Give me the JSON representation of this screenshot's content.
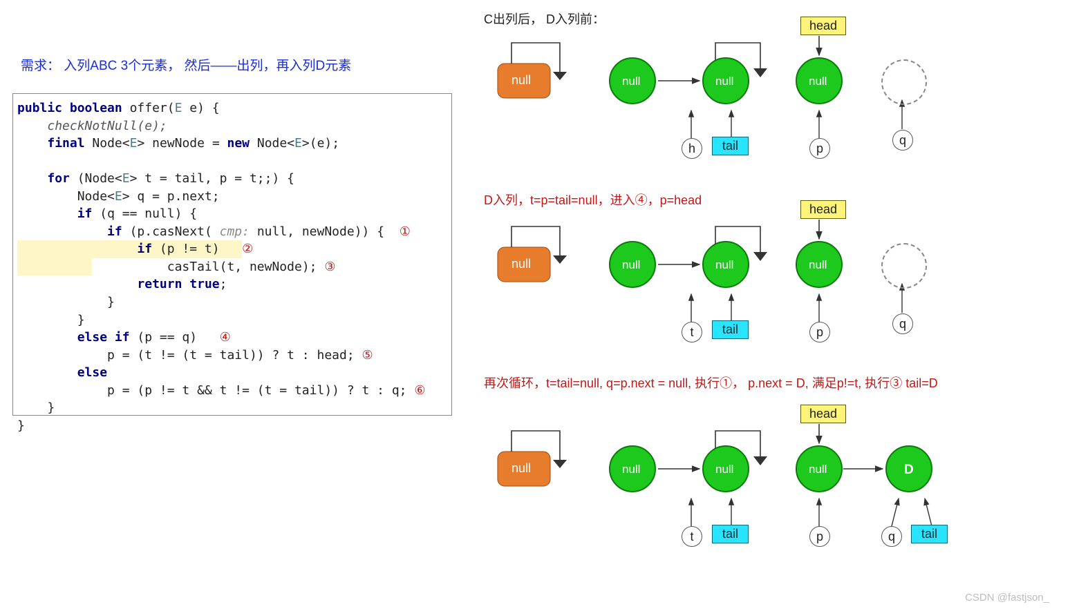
{
  "requirement": "需求： 入列ABC 3个元素， 然后——出列，再入列D元素",
  "code": {
    "sig_public": "public",
    "sig_boolean": "boolean",
    "sig_offer": " offer(",
    "sig_E": "E",
    "sig_rest": " e) {",
    "checkNotNull": "checkNotNull(e);",
    "final": "final",
    "Node": "Node",
    "E": "E",
    "newNodeDecl": " newNode = ",
    "new": "new",
    "newNodeCtor": " Node<",
    "newNodeEnd": ">(e);",
    "for": "for",
    "forCond": " (Node<",
    "forCond2": "> t = tail, p = t;;) {",
    "qDecl1": "Node<",
    "qDecl2": "> q = p.next;",
    "if": "if",
    "ifQ": " (q == null) {",
    "ifCas": " (p.casNext(",
    "cmp": " cmp: ",
    "ifCas2": "null, newNode)) {  ",
    "ann1": "①",
    "ifPT": " (p != t)   ",
    "ann2": "②",
    "casTail": "casTail(t, newNode); ",
    "ann3": "③",
    "return": "return",
    "true": "true",
    "elseif": "else if",
    "elseifC": " (p == q)   ",
    "ann4": "④",
    "line5a": "p = (t != (t = tail)) ? t : head; ",
    "ann5": "⑤",
    "else": "else",
    "line6a": "p = (p != t && t != (t = tail)) ? t : q; ",
    "ann6": "⑥"
  },
  "diagrams": {
    "caption1": "C出列后， D入列前：",
    "caption2": "D入列，t=p=tail=null，进入④，p=head",
    "caption3": "再次循环，t=tail=null,  q=p.next = null, 执行①， p.next = D, 满足p!=t, 执行③ tail=D",
    "head": "head",
    "tail": "tail",
    "null": "null",
    "D": "D",
    "h": "h",
    "t": "t",
    "p": "p",
    "q": "q"
  },
  "watermark": "CSDN @fastjson_",
  "chart_data": {
    "type": "diagram",
    "states": [
      {
        "label": "C出列后，D入列前",
        "nodes": [
          {
            "id": "n1",
            "value": "null",
            "color": "orange",
            "selfLoop": true
          },
          {
            "id": "n2",
            "value": "null",
            "color": "green"
          },
          {
            "id": "n3",
            "value": "null",
            "color": "green",
            "selfLoop": true
          },
          {
            "id": "n4",
            "value": "null",
            "color": "green"
          },
          {
            "id": "n5",
            "value": "(dashed)",
            "color": "none"
          }
        ],
        "edges": [
          [
            "n2",
            "n3"
          ]
        ],
        "markers": {
          "head": "n4",
          "tail": "n3",
          "h": "n2",
          "p": "n4",
          "q": "n5"
        }
      },
      {
        "label": "D入列，t=p=tail=null，进入④，p=head",
        "nodes": [
          {
            "id": "n1",
            "value": "null",
            "color": "orange",
            "selfLoop": true
          },
          {
            "id": "n2",
            "value": "null",
            "color": "green"
          },
          {
            "id": "n3",
            "value": "null",
            "color": "green",
            "selfLoop": true
          },
          {
            "id": "n4",
            "value": "null",
            "color": "green"
          },
          {
            "id": "n5",
            "value": "(dashed)",
            "color": "none"
          }
        ],
        "edges": [
          [
            "n2",
            "n3"
          ]
        ],
        "markers": {
          "head": "n4",
          "tail": "n3",
          "t": "n2",
          "p": "n4",
          "q": "n5"
        }
      },
      {
        "label": "再次循环，t=tail=null, q=p.next=null, 执行①，p.next=D, 满足p!=t, 执行③ tail=D",
        "nodes": [
          {
            "id": "n1",
            "value": "null",
            "color": "orange",
            "selfLoop": true
          },
          {
            "id": "n2",
            "value": "null",
            "color": "green"
          },
          {
            "id": "n3",
            "value": "null",
            "color": "green",
            "selfLoop": true
          },
          {
            "id": "n4",
            "value": "null",
            "color": "green"
          },
          {
            "id": "n5",
            "value": "D",
            "color": "green"
          }
        ],
        "edges": [
          [
            "n2",
            "n3"
          ],
          [
            "n4",
            "n5"
          ]
        ],
        "markers": {
          "head": "n4",
          "tail": "n5",
          "t": "n2",
          "p": "n4",
          "q": "n5_left"
        }
      }
    ]
  }
}
